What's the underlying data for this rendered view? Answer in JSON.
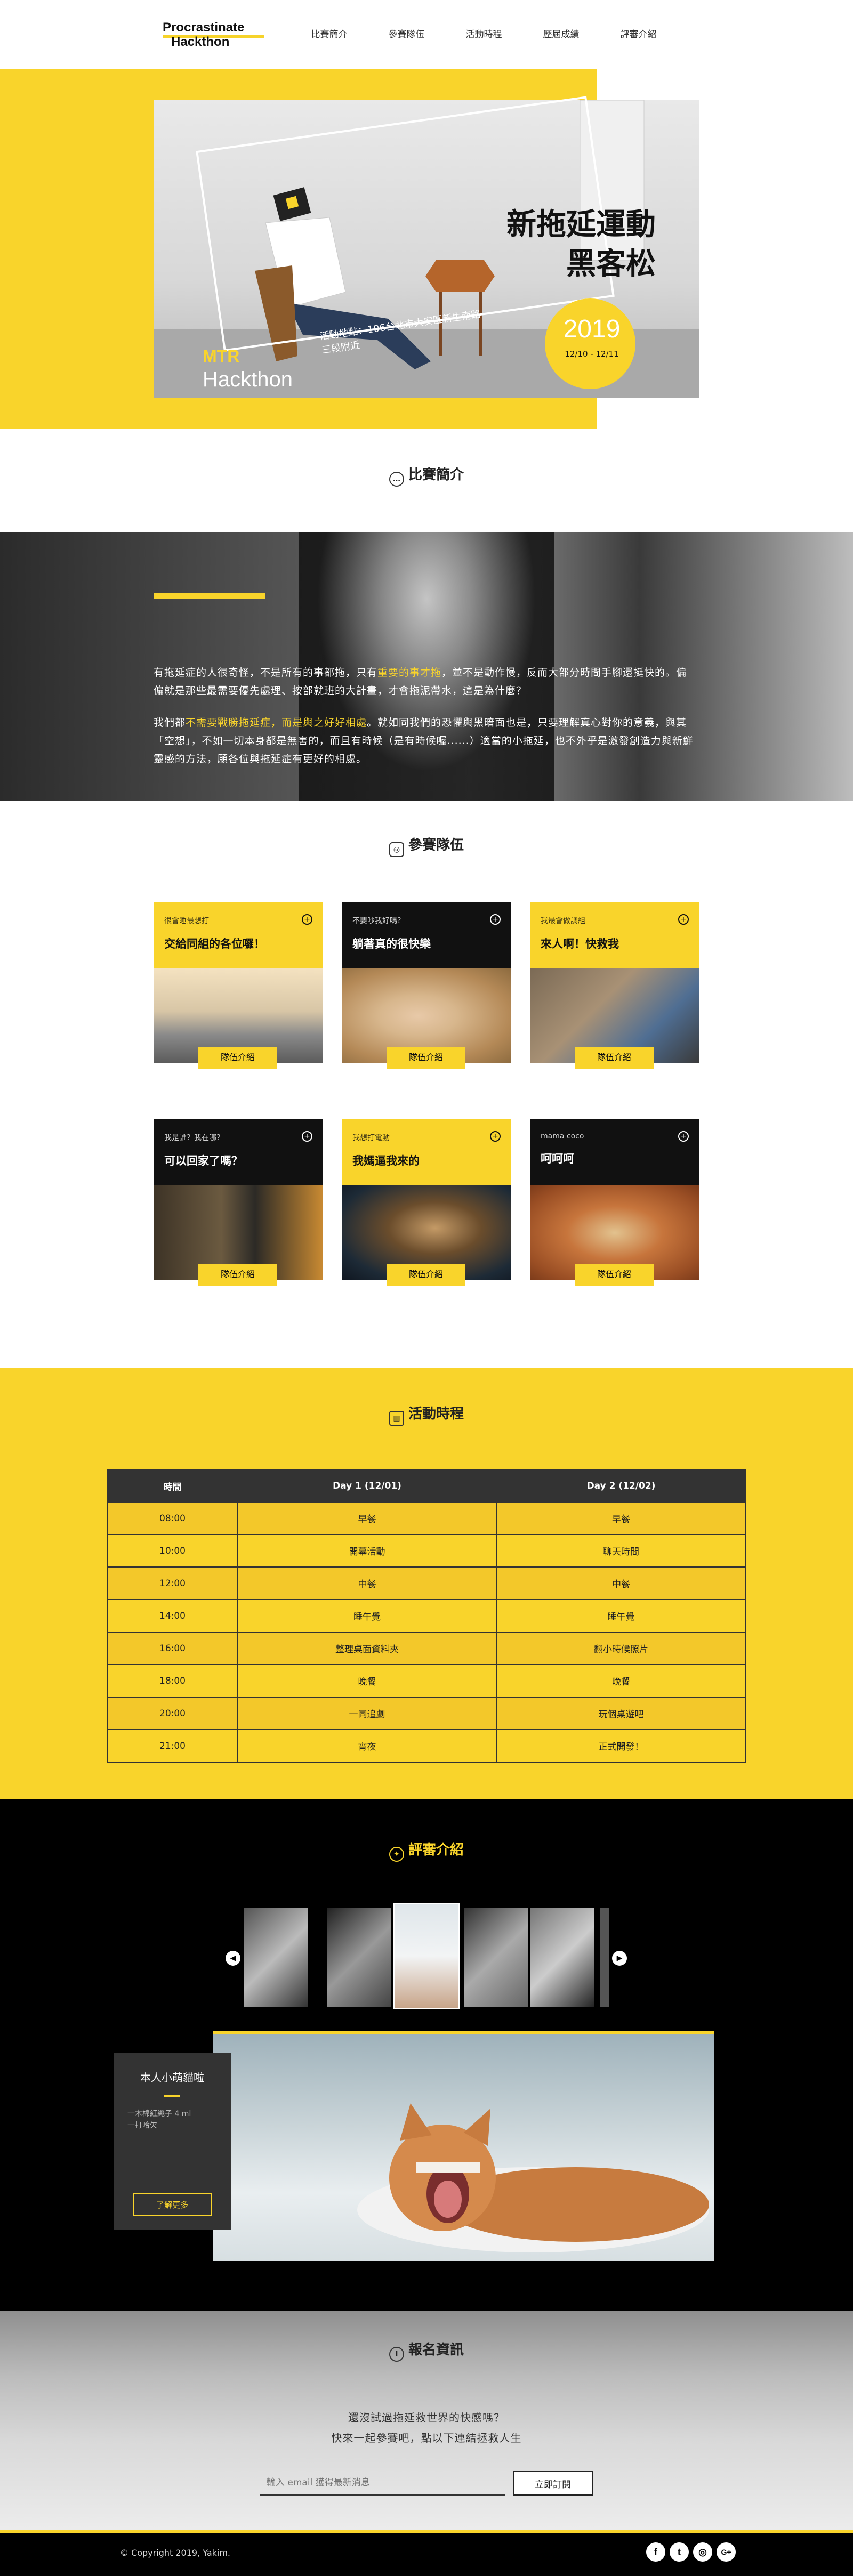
{
  "header": {
    "logo_line1": "Procrastinate",
    "logo_line2": "Hackthon",
    "nav": [
      "比賽簡介",
      "參賽隊伍",
      "活動時程",
      "歷屆成績",
      "評審介紹"
    ]
  },
  "hero": {
    "title_line1": "新拖延運動",
    "title_line2": "黑客松",
    "year": "2019",
    "date": "12/10 - 12/11",
    "mtr": "MTR",
    "hackthon": "Hackthon",
    "location": "活動地點：106台北市大安區新生南路三段附近"
  },
  "intro": {
    "title": "比賽簡介",
    "para1_a": "有拖延症的人很奇怪，不是所有的事都拖，只有",
    "para1_hl": "重要的事才拖",
    "para1_b": "，並不是動作慢，反而大部分時間手腳還挺快的。偏偏就是那些最需要優先處理、按部就班的大計畫，才會拖泥帶水，這是為什麼？",
    "para2_a": "我們都",
    "para2_hl": "不需要戰勝拖延症，而是與之好好相處",
    "para2_b": "。就如同我們的恐懼與黑暗面也是，只要理解真心對你的意義，與其「空想」，不如一切本身都是無害的，而且有時候（是有時候喔......）適當的小拖延，也不外乎是激發創造力與新鮮靈感的方法，願各位與拖延症有更好的相處。"
  },
  "teams": {
    "title": "參賽隊伍",
    "button_label": "隊伍介紹",
    "items": [
      {
        "sub": "很會睡最想打",
        "name": "交給同組的各位囉！",
        "theme": "yellow"
      },
      {
        "sub": "不要吵我好嗎？",
        "name": "躺著真的很快樂",
        "theme": "black"
      },
      {
        "sub": "我最會做調組",
        "name": "來人啊！快救我",
        "theme": "yellow"
      },
      {
        "sub": "我是誰？我在哪？",
        "name": "可以回家了嗎？",
        "theme": "black"
      },
      {
        "sub": "我想打電動",
        "name": "我媽逼我來的",
        "theme": "yellow"
      },
      {
        "sub": "mama coco",
        "name": "呵呵呵",
        "theme": "black"
      }
    ]
  },
  "schedule": {
    "title": "活動時程",
    "headers": [
      "時間",
      "Day 1 (12/01)",
      "Day 2 (12/02)"
    ],
    "rows": [
      [
        "08:00",
        "早餐",
        "早餐"
      ],
      [
        "10:00",
        "開幕活動",
        "聊天時間"
      ],
      [
        "12:00",
        "中餐",
        "中餐"
      ],
      [
        "14:00",
        "睡午覺",
        "睡午覺"
      ],
      [
        "16:00",
        "整理桌面資料夾",
        "翻小時候照片"
      ],
      [
        "18:00",
        "晚餐",
        "晚餐"
      ],
      [
        "20:00",
        "一同追劇",
        "玩個桌遊吧"
      ],
      [
        "21:00",
        "宵夜",
        "正式開發！"
      ]
    ]
  },
  "judges": {
    "title": "評審介紹",
    "name": "本人小萌貓啦",
    "items": [
      "一木棉紅繩子 4 ml",
      "一打哈欠"
    ],
    "more_label": "了解更多"
  },
  "signup": {
    "title": "報名資訊",
    "line1": "還沒試過拖延救世界的快感嗎？",
    "line2": "快來一起參賽吧，點以下連結拯救人生",
    "placeholder": "輸入 email 獲得最新消息",
    "button": "立即訂閱"
  },
  "footer": {
    "copyright": "© Copyright 2019, Yakim.",
    "social": [
      "f",
      "t",
      "◎",
      "G+"
    ]
  },
  "colors": {
    "accent": "#f9d42b",
    "dark": "#111111"
  }
}
